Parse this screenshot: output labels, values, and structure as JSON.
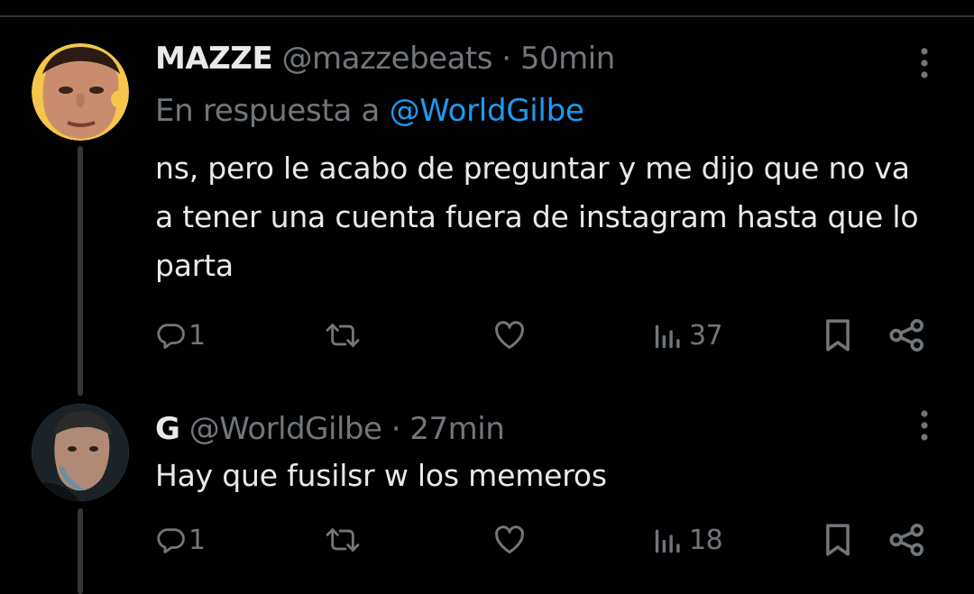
{
  "tweets": [
    {
      "display_name": "MAZZE",
      "handle": "@mazzebeats",
      "separator": "·",
      "time": "50min",
      "reply_prefix": "En respuesta a",
      "reply_to": "@WorldGilbe",
      "text": "ns, pero le acabo de preguntar y me dijo que no va a tener una cuenta fuera de instagram hasta que lo parta",
      "replies": "1",
      "retweets": "",
      "likes": "",
      "views": "37"
    },
    {
      "display_name": "G",
      "handle": "@WorldGilbe",
      "separator": "·",
      "time": "27min",
      "text": "Hay que fusilsr w los memeros",
      "replies": "1",
      "retweets": "",
      "likes": "",
      "views": "18"
    }
  ],
  "icons": {
    "more": "more-vertical-icon",
    "reply": "reply-bubble-icon",
    "retweet": "retweet-icon",
    "like": "heart-icon",
    "views": "views-bar-chart-icon",
    "bookmark": "bookmark-icon",
    "share": "share-icon"
  },
  "colors": {
    "background": "#000000",
    "text": "#e7e9ea",
    "secondary": "#71767b",
    "link": "#1d9bf0",
    "thread_line": "#333639"
  }
}
